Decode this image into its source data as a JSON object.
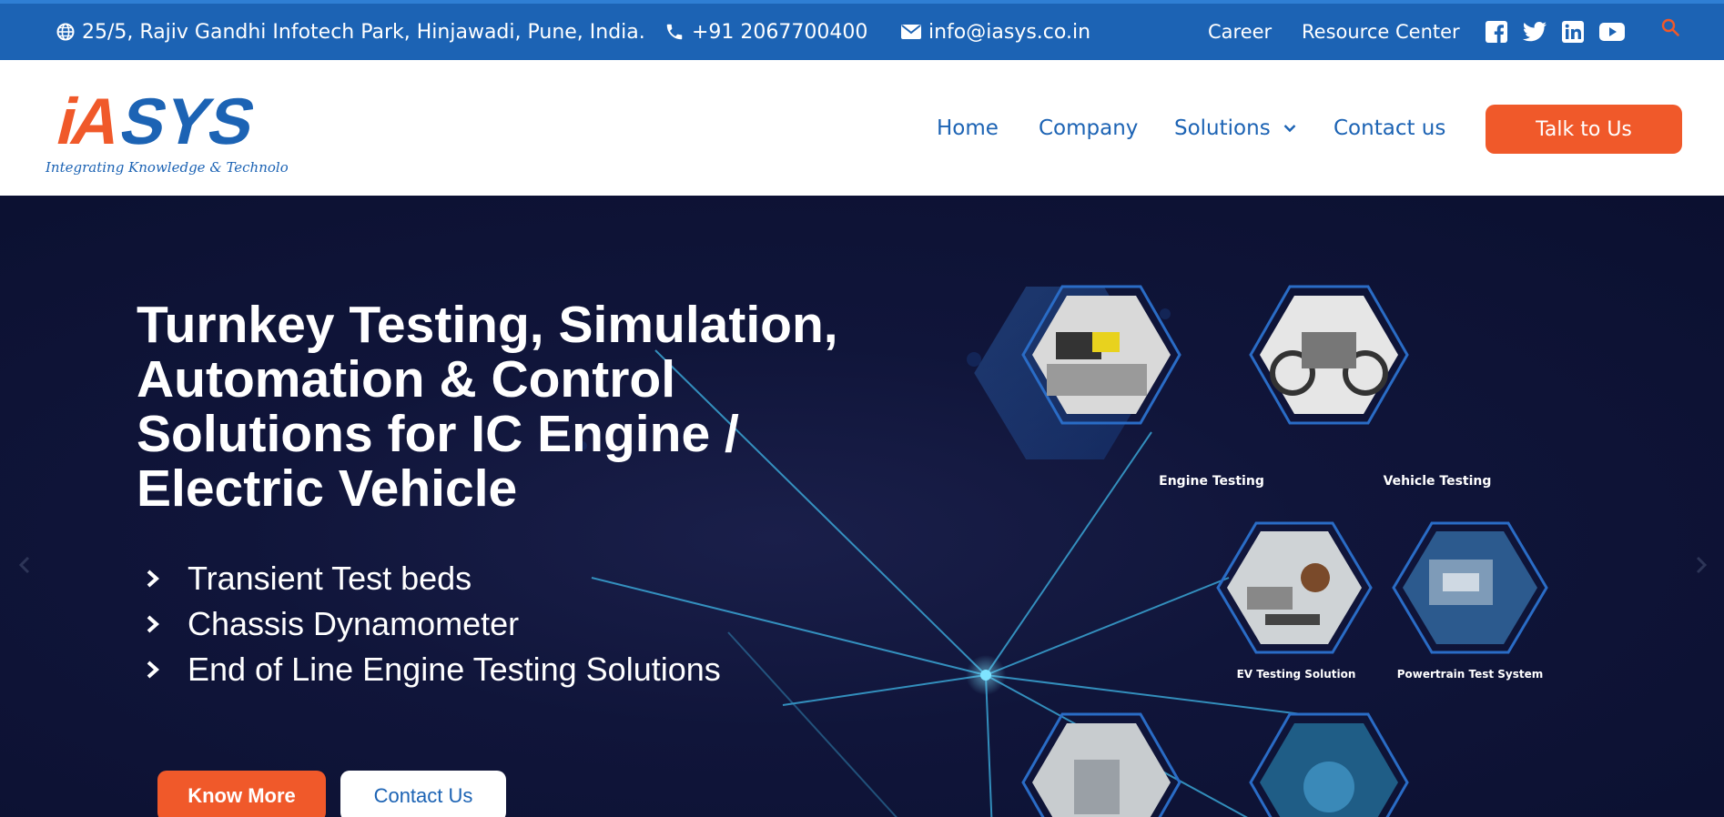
{
  "topbar": {
    "address": "25/5, Rajiv Gandhi Infotech Park, Hinjawadi, Pune, India.",
    "phone": "+91 2067700400",
    "email": "info@iasys.co.in",
    "career": "Career",
    "resource_center": "Resource Center",
    "social_icons": [
      "facebook-icon",
      "twitter-icon",
      "linkedin-icon",
      "youtube-icon"
    ],
    "search_icon": "search-icon"
  },
  "header": {
    "logo_text": "iASYS",
    "logo_tagline": "Integrating Knowledge & Technology",
    "nav": [
      "Home",
      "Company",
      "Solutions",
      "Contact us"
    ],
    "cta": "Talk to Us"
  },
  "hero": {
    "title": "Turnkey Testing, Simulation, Automation & Control Solutions for IC Engine / Electric Vehicle",
    "bullets": [
      "Transient Test beds",
      "Chassis Dynamometer",
      "End of Line Engine Testing Solutions"
    ],
    "know_more": "Know More",
    "contact_us": "Contact Us",
    "solutions": [
      {
        "label": "Engine Testing",
        "icon": "engine-test-bed-image"
      },
      {
        "label": "Vehicle Testing",
        "icon": "motorcycle-image"
      },
      {
        "label": "EV Testing Solution",
        "icon": "ev-components-image"
      },
      {
        "label": "Powertrain Test System",
        "icon": "powertrain-image"
      },
      {
        "label": "",
        "icon": "machine-image"
      },
      {
        "label": "",
        "icon": "pump-image"
      }
    ]
  },
  "colors": {
    "brand_blue": "#1c63b4",
    "accent_orange": "#f0592a",
    "hero_bg": "#0e1435"
  }
}
